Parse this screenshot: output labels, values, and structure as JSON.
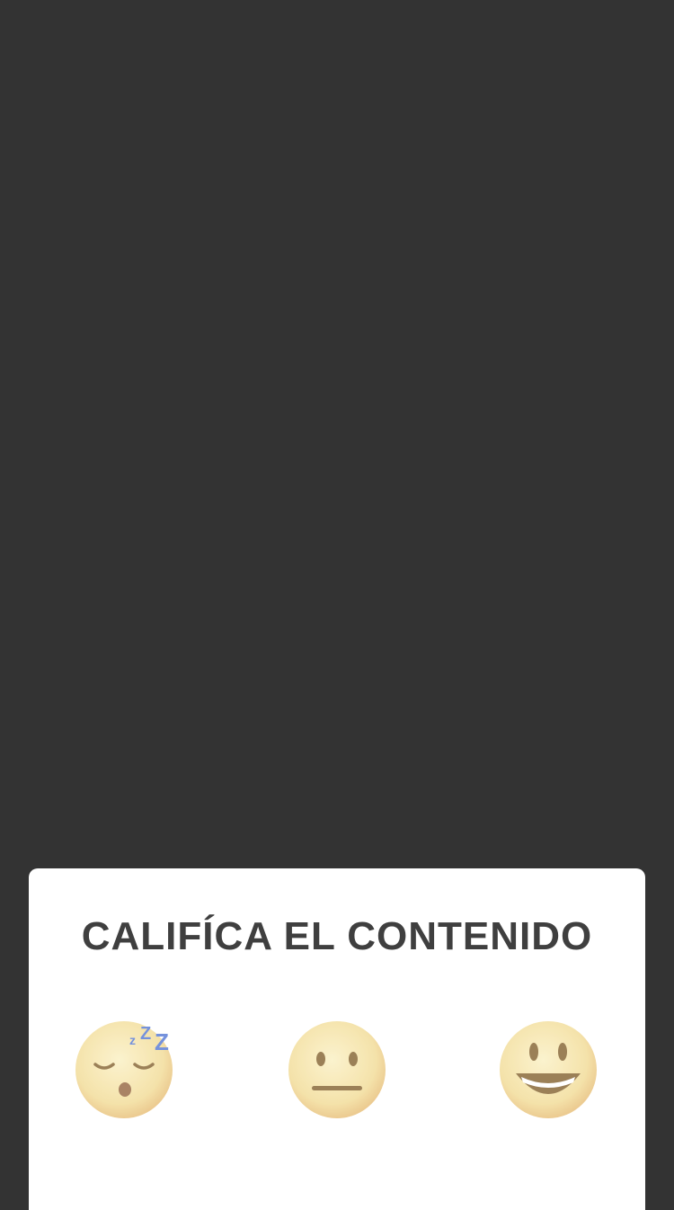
{
  "screen": {
    "background_color": "#333333"
  },
  "rating_sheet": {
    "title": "CALIFÍCA EL CONTENIDO",
    "options": [
      {
        "name": "sleepy",
        "icon": "sleepy-face-icon"
      },
      {
        "name": "neutral",
        "icon": "neutral-face-icon"
      },
      {
        "name": "happy",
        "icon": "smiling-face-icon"
      }
    ]
  },
  "colors": {
    "face_fill": "#F5E6A8",
    "face_shade": "#EAC77F",
    "feature": "#8A6A3A",
    "zzz": "#5E7FD6",
    "title": "#3F3F3F"
  }
}
